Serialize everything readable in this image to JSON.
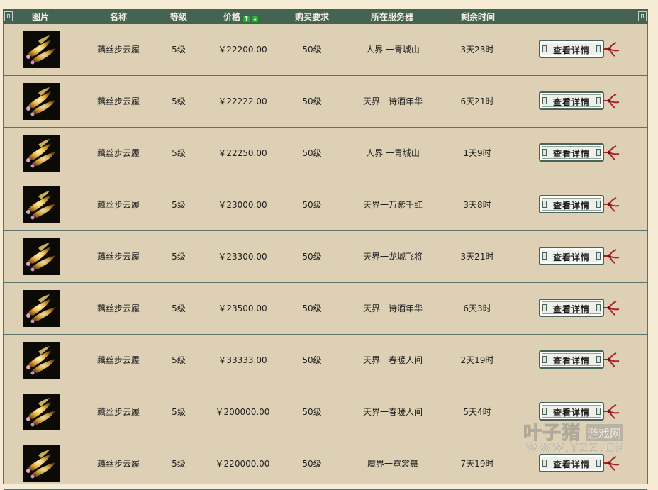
{
  "header": {
    "col_image": "图片",
    "col_name": "名称",
    "col_level": "等级",
    "col_price": "价格",
    "col_requirement": "购买要求",
    "col_server": "所在服务器",
    "col_time": "剩余时间",
    "sort_up_glyph": "↑",
    "sort_down_glyph": "↓"
  },
  "rows": [
    {
      "name": "藕丝步云履",
      "level": "5级",
      "price": "￥22200.00",
      "requirement": "50级",
      "server": "人界 一青城山",
      "time": "3天23时",
      "button": "查看详情"
    },
    {
      "name": "藕丝步云履",
      "level": "5级",
      "price": "￥22222.00",
      "requirement": "50级",
      "server": "天界一诗酒年华",
      "time": "6天21时",
      "button": "查看详情"
    },
    {
      "name": "藕丝步云履",
      "level": "5级",
      "price": "￥22250.00",
      "requirement": "50级",
      "server": "人界 一青城山",
      "time": "1天9时",
      "button": "查看详情"
    },
    {
      "name": "藕丝步云履",
      "level": "5级",
      "price": "￥23000.00",
      "requirement": "50级",
      "server": "天界一万紫千红",
      "time": "3天8时",
      "button": "查看详情"
    },
    {
      "name": "藕丝步云履",
      "level": "5级",
      "price": "￥23300.00",
      "requirement": "50级",
      "server": "天界一龙城飞将",
      "time": "3天21时",
      "button": "查看详情"
    },
    {
      "name": "藕丝步云履",
      "level": "5级",
      "price": "￥23500.00",
      "requirement": "50级",
      "server": "天界一诗酒年华",
      "time": "6天3时",
      "button": "查看详情"
    },
    {
      "name": "藕丝步云履",
      "level": "5级",
      "price": "￥33333.00",
      "requirement": "50级",
      "server": "天界一春暖人间",
      "time": "2天19时",
      "button": "查看详情"
    },
    {
      "name": "藕丝步云履",
      "level": "5级",
      "price": "￥200000.00",
      "requirement": "50级",
      "server": "天界一春暖人间",
      "time": "5天4时",
      "button": "查看详情"
    },
    {
      "name": "藕丝步云履",
      "level": "5级",
      "price": "￥220000.00",
      "requirement": "50级",
      "server": "魔界一霓裳舞",
      "time": "7天19时",
      "button": "查看详情"
    }
  ],
  "watermark": {
    "brand": "叶子猪",
    "tag": "游戏网",
    "url": "WWW.YZZ.CN"
  },
  "colors": {
    "header_bg": "#456353",
    "row_bg": "#ddd0b4",
    "border": "#5e7468",
    "sort_icon": "#2fa53a",
    "tassel": "#a8202a"
  },
  "icons": {
    "item_image": "golden-cloud-boots-icon",
    "tassel": "red-tassel-icon",
    "sort_asc": "arrow-up-icon",
    "sort_desc": "arrow-down-icon"
  }
}
